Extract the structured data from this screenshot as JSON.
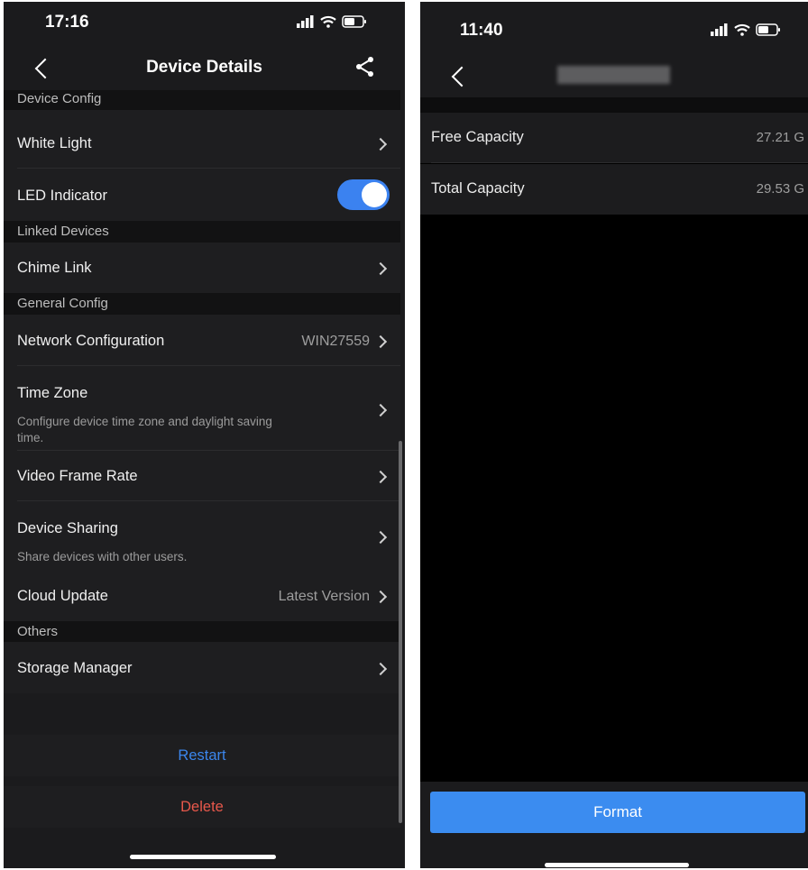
{
  "left": {
    "status": {
      "time": "17:16"
    },
    "nav": {
      "title": "Device Details",
      "back_icon": "chevron-left-icon",
      "share_icon": "share-icon"
    },
    "sections": {
      "device_config": "Device Config",
      "linked_devices": "Linked Devices",
      "general_config": "General Config",
      "others": "Others"
    },
    "rows": {
      "white_light": {
        "label": "White Light"
      },
      "led_indicator": {
        "label": "LED Indicator",
        "enabled": true
      },
      "chime_link": {
        "label": "Chime Link"
      },
      "network_config": {
        "label": "Network Configuration",
        "value": "WIN27559"
      },
      "time_zone": {
        "label": "Time Zone",
        "desc": "Configure device time zone and daylight saving time."
      },
      "video_frame_rate": {
        "label": "Video Frame Rate"
      },
      "device_sharing": {
        "label": "Device Sharing",
        "desc": "Share devices with other users."
      },
      "cloud_update": {
        "label": "Cloud Update",
        "value": "Latest Version"
      },
      "storage_manager": {
        "label": "Storage Manager"
      }
    },
    "actions": {
      "restart": "Restart",
      "delete": "Delete"
    },
    "colors": {
      "restart": "#3b86ec",
      "delete": "#e8584b",
      "toggle_on": "#3b82f0"
    }
  },
  "right": {
    "status": {
      "time": "11:40"
    },
    "nav": {
      "back_icon": "chevron-left-icon"
    },
    "rows": {
      "free": {
        "label": "Free Capacity",
        "value": "27.21 G"
      },
      "total": {
        "label": "Total Capacity",
        "value": "29.53 G"
      }
    },
    "format_button": "Format",
    "colors": {
      "format": "#3b8cf0"
    }
  }
}
